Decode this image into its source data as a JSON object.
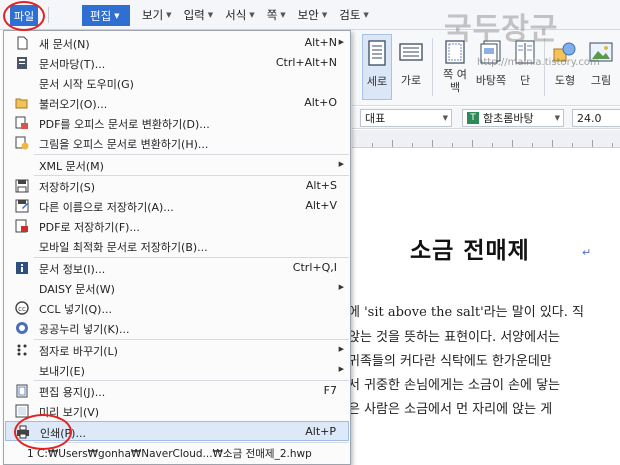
{
  "menubar": {
    "file": "파일",
    "edit": "편집",
    "items": [
      "보기",
      "입력",
      "서식",
      "쪽",
      "보안",
      "검토"
    ]
  },
  "watermark": {
    "text": "국두장군",
    "url": "http://mainia.tistory.com"
  },
  "ribbon": {
    "buttons": [
      "세로",
      "가로",
      "쪽 여백",
      "바탕쪽",
      "단",
      "도형",
      "그림"
    ]
  },
  "formatbar": {
    "style": "대표",
    "font": "함초롬바탕",
    "size": "24.0"
  },
  "document": {
    "title": "소금 전매제",
    "lines": [
      "에 'sit above the salt'라는 말이 있다. 직",
      " 앉는 것을 뜻하는 표현이다. 서양에서는",
      " 귀족들의 커다란 식탁에도 한가운데만",
      "서 귀중한 손님에게는 소금이 손에 닿는",
      "은 사람은 소금에서 먼 자리에 앉는 게"
    ]
  },
  "file_menu": {
    "items": [
      {
        "label": "새 문서(N)",
        "shortcut": "Alt+N",
        "icon": "new-document-icon",
        "submenu": true
      },
      {
        "label": "문서마당(T)...",
        "shortcut": "Ctrl+Alt+N",
        "icon": "template-icon",
        "submenu": false
      },
      {
        "label": "문서 시작 도우미(G)",
        "shortcut": "",
        "icon": "",
        "submenu": false
      },
      {
        "label": "불러오기(O)...",
        "shortcut": "Alt+O",
        "icon": "open-folder-icon",
        "submenu": false
      },
      {
        "label": "PDF를 오피스 문서로 변환하기(D)...",
        "shortcut": "",
        "icon": "pdf-convert-icon",
        "submenu": false
      },
      {
        "label": "그림을 오피스 문서로 변환하기(H)...",
        "shortcut": "",
        "icon": "image-convert-icon",
        "submenu": false
      },
      {
        "label": "XML 문서(M)",
        "shortcut": "",
        "icon": "",
        "submenu": true
      },
      {
        "label": "저장하기(S)",
        "shortcut": "Alt+S",
        "icon": "save-icon",
        "submenu": false
      },
      {
        "label": "다른 이름으로 저장하기(A)...",
        "shortcut": "Alt+V",
        "icon": "save-as-icon",
        "submenu": false
      },
      {
        "label": "PDF로 저장하기(F)...",
        "shortcut": "",
        "icon": "save-pdf-icon",
        "submenu": false
      },
      {
        "label": "모바일 최적화 문서로 저장하기(B)...",
        "shortcut": "",
        "icon": "",
        "submenu": false
      },
      {
        "label": "문서 정보(I)...",
        "shortcut": "Ctrl+Q,I",
        "icon": "document-info-icon",
        "submenu": false
      },
      {
        "label": "DAISY 문서(W)",
        "shortcut": "",
        "icon": "",
        "submenu": true
      },
      {
        "label": "CCL 넣기(Q)...",
        "shortcut": "",
        "icon": "ccl-icon",
        "submenu": false
      },
      {
        "label": "공공누리 넣기(K)...",
        "shortcut": "",
        "icon": "kogl-icon",
        "submenu": false
      },
      {
        "label": "점자로 바꾸기(L)",
        "shortcut": "",
        "icon": "braille-icon",
        "submenu": true
      },
      {
        "label": "보내기(E)",
        "shortcut": "",
        "icon": "",
        "submenu": true
      },
      {
        "label": "편집 용지(J)...",
        "shortcut": "F7",
        "icon": "page-setup-icon",
        "submenu": false
      },
      {
        "label": "미리 보기(V)",
        "shortcut": "",
        "icon": "preview-icon",
        "submenu": false
      },
      {
        "label": "인쇄(P)...",
        "shortcut": "Alt+P",
        "icon": "printer-icon",
        "submenu": false
      },
      {
        "label": "1 C:₩Users₩gonha₩NaverCloud...₩소금 전매제_2.hwp",
        "shortcut": "",
        "icon": "",
        "submenu": false
      }
    ]
  }
}
